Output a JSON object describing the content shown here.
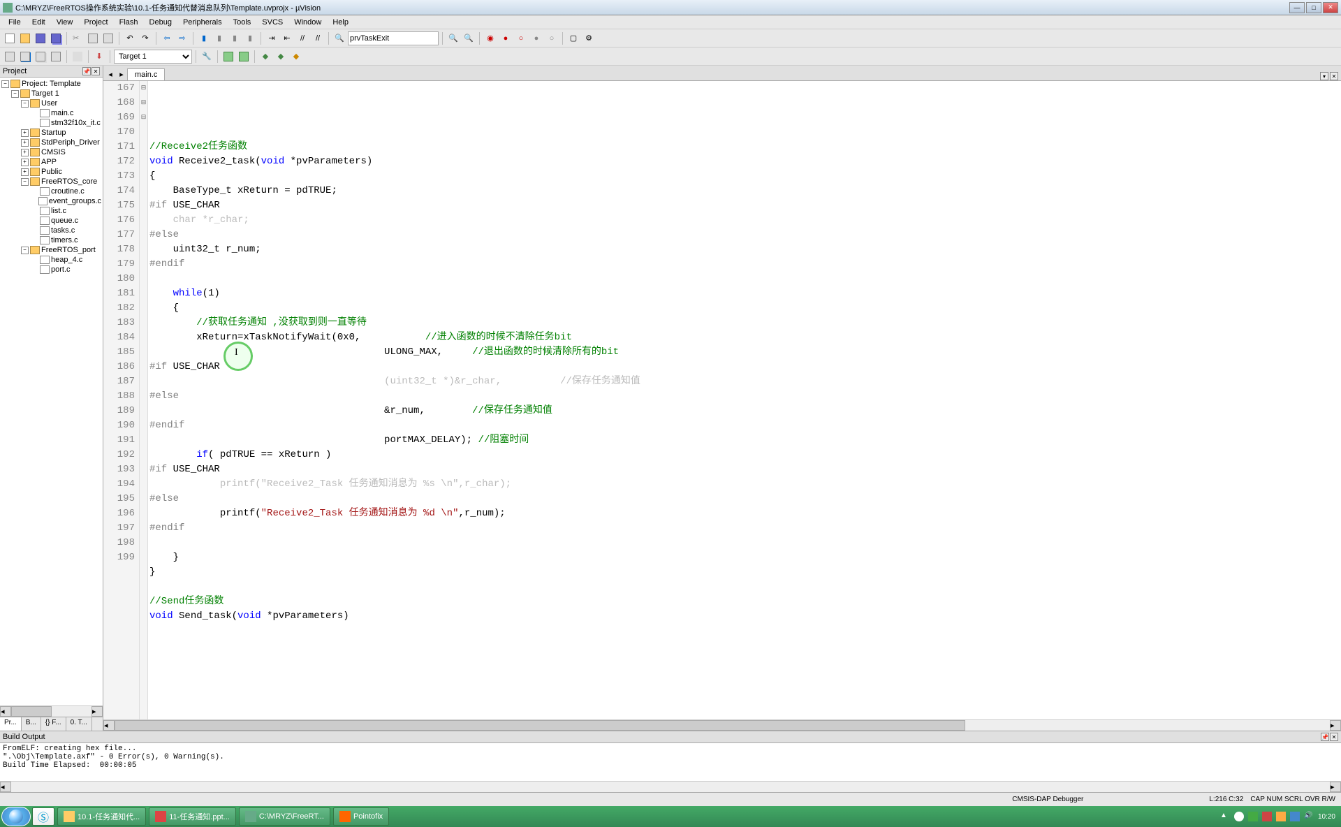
{
  "title": "C:\\MRYZ\\FreeRTOS操作系统实验\\10.1-任务通知代替消息队列\\Template.uvprojx - µVision",
  "menus": [
    "File",
    "Edit",
    "View",
    "Project",
    "Flash",
    "Debug",
    "Peripherals",
    "Tools",
    "SVCS",
    "Window",
    "Help"
  ],
  "toolbar": {
    "combo1": "prvTaskExit",
    "combo2": "Target 1"
  },
  "project": {
    "title": "Project",
    "root": "Project: Template",
    "target": "Target 1",
    "groups": [
      {
        "name": "User",
        "files": [
          "main.c",
          "stm32f10x_it.c"
        ]
      },
      {
        "name": "Startup",
        "files": []
      },
      {
        "name": "StdPeriph_Driver",
        "files": []
      },
      {
        "name": "CMSIS",
        "files": []
      },
      {
        "name": "APP",
        "files": []
      },
      {
        "name": "Public",
        "files": []
      },
      {
        "name": "FreeRTOS_core",
        "files": [
          "croutine.c",
          "event_groups.c",
          "list.c",
          "queue.c",
          "tasks.c",
          "timers.c"
        ]
      },
      {
        "name": "FreeRTOS_port",
        "files": [
          "heap_4.c",
          "port.c"
        ]
      }
    ],
    "tabs": [
      "Pr...",
      "B...",
      "{} F...",
      "0. T..."
    ]
  },
  "editor": {
    "active_file": "main.c",
    "first_line": 167,
    "lines": [
      {
        "n": 167,
        "f": "",
        "html": "<span class='cm'>//Receive2任务函数</span>"
      },
      {
        "n": 168,
        "f": "",
        "html": "<span class='kw'>void</span> Receive2_task(<span class='kw'>void</span> *pvParameters)"
      },
      {
        "n": 169,
        "f": "⊟",
        "html": "{"
      },
      {
        "n": 170,
        "f": "",
        "html": "    BaseType_t xReturn = pdTRUE;"
      },
      {
        "n": 171,
        "f": "",
        "html": "<span class='pp'>#if</span> USE_CHAR"
      },
      {
        "n": 172,
        "f": "",
        "html": "    <span class='grey'>char *r_char;</span>"
      },
      {
        "n": 173,
        "f": "",
        "html": "<span class='pp'>#else</span>"
      },
      {
        "n": 174,
        "f": "",
        "html": "    uint32_t r_num;"
      },
      {
        "n": 175,
        "f": "",
        "html": "<span class='pp'>#endif</span>"
      },
      {
        "n": 176,
        "f": "",
        "html": ""
      },
      {
        "n": 177,
        "f": "",
        "html": "    <span class='kw'>while</span>(1)"
      },
      {
        "n": 178,
        "f": "⊟",
        "html": "    {"
      },
      {
        "n": 179,
        "f": "",
        "html": "        <span class='cm'>//获取任务通知 ,没获取到则一直等待</span>"
      },
      {
        "n": 180,
        "f": "⊟",
        "html": "        xReturn=xTaskNotifyWait(0x0,           <span class='cm'>//进入函数的时候不清除任务bit</span>"
      },
      {
        "n": 181,
        "f": "",
        "html": "                                        ULONG_MAX,     <span class='cm'>//退出函数的时候清除所有的bit</span>"
      },
      {
        "n": 182,
        "f": "",
        "html": "<span class='pp'>#if</span> USE_CHAR"
      },
      {
        "n": 183,
        "f": "",
        "html": "                                        <span class='grey'>(uint32_t *)&amp;r_char,          //保存任务通知值</span>"
      },
      {
        "n": 184,
        "f": "",
        "html": "<span class='pp'>#else</span>"
      },
      {
        "n": 185,
        "f": "",
        "html": "                                        &amp;r_num,        <span class='cm'>//保存任务通知值</span>"
      },
      {
        "n": 186,
        "f": "",
        "html": "<span class='pp'>#endif</span>"
      },
      {
        "n": 187,
        "f": "",
        "html": "                                        portMAX_DELAY); <span class='cm'>//阻塞时间</span>"
      },
      {
        "n": 188,
        "f": "",
        "html": "        <span class='kw'>if</span>( pdTRUE == xReturn )"
      },
      {
        "n": 189,
        "f": "",
        "html": "<span class='pp'>#if</span> USE_CHAR"
      },
      {
        "n": 190,
        "f": "",
        "html": "            <span class='grey'>printf(\"Receive2_Task 任务通知消息为 %s \\n\",r_char);</span>"
      },
      {
        "n": 191,
        "f": "",
        "html": "<span class='pp'>#else</span>"
      },
      {
        "n": 192,
        "f": "",
        "html": "            printf(<span class='str'>\"Receive2_Task 任务通知消息为 %d \\n\"</span>,r_num);"
      },
      {
        "n": 193,
        "f": "",
        "html": "<span class='pp'>#endif</span>"
      },
      {
        "n": 194,
        "f": "",
        "html": ""
      },
      {
        "n": 195,
        "f": "",
        "html": "    }"
      },
      {
        "n": 196,
        "f": "",
        "html": "}"
      },
      {
        "n": 197,
        "f": "",
        "html": ""
      },
      {
        "n": 198,
        "f": "",
        "html": "<span class='cm'>//Send任务函数</span>"
      },
      {
        "n": 199,
        "f": "",
        "html": "<span class='kw'>void</span> Send_task(<span class='kw'>void</span> *pvParameters)"
      }
    ]
  },
  "output": {
    "title": "Build Output",
    "text": "FromELF: creating hex file...\n\".\\Obj\\Template.axf\" - 0 Error(s), 0 Warning(s).\nBuild Time Elapsed:  00:00:05"
  },
  "status": {
    "debugger": "CMSIS-DAP Debugger",
    "pos": "L:216 C:32",
    "flags": "CAP  NUM  SCRL  OVR  R/W"
  },
  "taskbar": {
    "items": [
      "10.1-任务通知代...",
      "11-任务通知.ppt...",
      "C:\\MRYZ\\FreeRT...",
      "Pointofix"
    ],
    "time": "10:20"
  }
}
